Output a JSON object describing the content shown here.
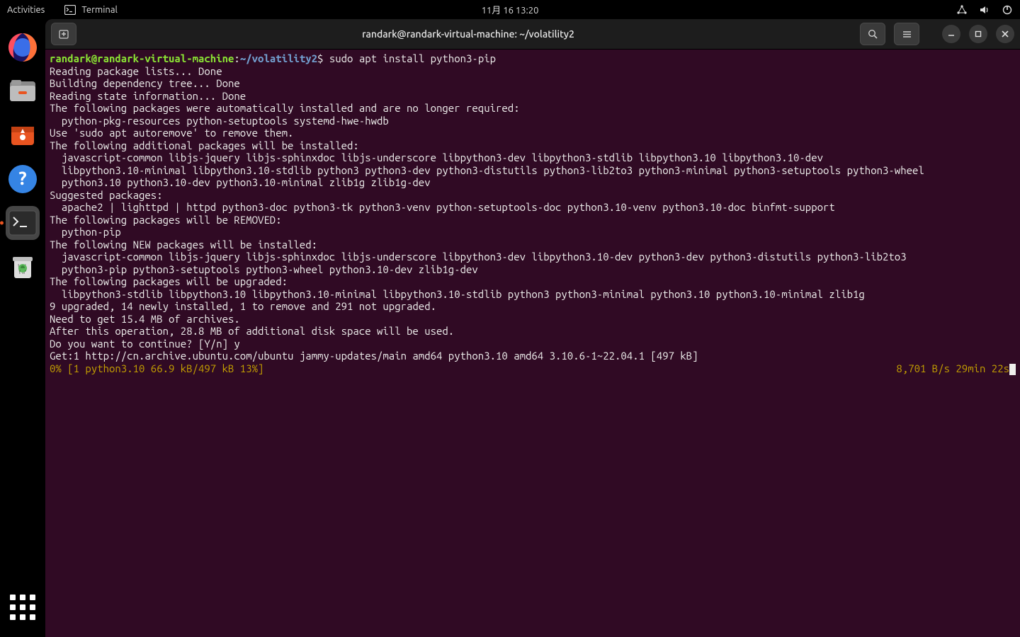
{
  "panel": {
    "activities": "Activities",
    "app_name": "Terminal",
    "clock": "11月 16  13:20"
  },
  "dock": {
    "items": [
      {
        "name": "firefox",
        "running": false
      },
      {
        "name": "files",
        "running": false
      },
      {
        "name": "software",
        "running": false
      },
      {
        "name": "help",
        "running": false
      },
      {
        "name": "terminal",
        "running": true
      },
      {
        "name": "trash",
        "running": false
      }
    ]
  },
  "window": {
    "title": "randark@randark-virtual-machine: ~/volatility2"
  },
  "prompt": {
    "userhost": "randark@randark-virtual-machine",
    "colon": ":",
    "path": "~/volatility2",
    "dollar": "$ ",
    "command": "sudo apt install python3-pip"
  },
  "output_lines": [
    "Reading package lists... Done",
    "Building dependency tree... Done",
    "Reading state information... Done",
    "The following packages were automatically installed and are no longer required:",
    "  python-pkg-resources python-setuptools systemd-hwe-hwdb",
    "Use 'sudo apt autoremove' to remove them.",
    "The following additional packages will be installed:",
    "  javascript-common libjs-jquery libjs-sphinxdoc libjs-underscore libpython3-dev libpython3-stdlib libpython3.10 libpython3.10-dev",
    "  libpython3.10-minimal libpython3.10-stdlib python3 python3-dev python3-distutils python3-lib2to3 python3-minimal python3-setuptools python3-wheel",
    "  python3.10 python3.10-dev python3.10-minimal zlib1g zlib1g-dev",
    "Suggested packages:",
    "  apache2 | lighttpd | httpd python3-doc python3-tk python3-venv python-setuptools-doc python3.10-venv python3.10-doc binfmt-support",
    "The following packages will be REMOVED:",
    "  python-pip",
    "The following NEW packages will be installed:",
    "  javascript-common libjs-jquery libjs-sphinxdoc libjs-underscore libpython3-dev libpython3.10-dev python3-dev python3-distutils python3-lib2to3",
    "  python3-pip python3-setuptools python3-wheel python3.10-dev zlib1g-dev",
    "The following packages will be upgraded:",
    "  libpython3-stdlib libpython3.10 libpython3.10-minimal libpython3.10-stdlib python3 python3-minimal python3.10 python3.10-minimal zlib1g",
    "9 upgraded, 14 newly installed, 1 to remove and 291 not upgraded.",
    "Need to get 15.4 MB of archives.",
    "After this operation, 28.8 MB of additional disk space will be used.",
    "Do you want to continue? [Y/n] y",
    "Get:1 http://cn.archive.ubuntu.com/ubuntu jammy-updates/main amd64 python3.10 amd64 3.10.6-1~22.04.1 [497 kB]"
  ],
  "progress": {
    "left": "0% [1 python3.10 66.9 kB/497 kB 13%]",
    "right": "8,701 B/s 29min 22s"
  }
}
